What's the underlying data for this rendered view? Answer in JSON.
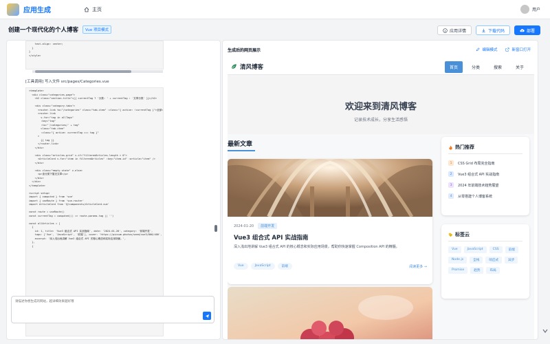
{
  "topbar": {
    "brand": "应用生成",
    "home_label": "主页",
    "user_label": "用户"
  },
  "header": {
    "title": "创建一个现代化的个人博客",
    "mode_tag": "Vue 项目模式",
    "details_btn": "应用详情",
    "download_btn": "下载代码",
    "deploy_btn": "部署"
  },
  "left": {
    "code_top": "    text-align: center;\n  }\n}\n</style>",
    "tool_line": "[工具调用] 写入文件 src/pages/Categories.vue",
    "code_main": "<template>\n  <div class=\"categories-page\">\n    <h2 class=\"section-title\">{{ currentTag ? '分类: ' + currentTag : '文章分类' }}</h2>\n\n    <div class=\"category-tabs\">\n      <router-link to=\"/categories\" class=\"tab-item\" :class=\"{ active: !currentTag }\">全部</router-link>\n      <router-link\n        v-for=\"tag in allTags\"\n        :key=\"tag\"\n        :to=\"'/categories/' + tag\"\n        class=\"tab-item\"\n        :class=\"{ active: currentTag === tag }\"\n      >\n        {{ tag }}\n      </router-link>\n    </div>\n\n    <div class=\"articles-grid\" v-if=\"filteredArticles.length > 0\">\n      <ArticleCard v-for=\"item in filteredArticles\" :key=\"item.id\" :article=\"item\" />\n    </div>\n\n    <div class=\"empty-state\" v-else>\n      <p>该分类下暂无文章</p>\n    </div>\n  </div>\n</template>\n\n<script setup>\nimport { computed } from 'vue'\nimport { useRoute } from 'vue-router'\nimport ArticleCard from '@/components/ArticleCard.vue'\n\nconst route = useRoute()\nconst currentTag = computed(() => route.params.tag || '')\n\nconst allArticles = [\n  {\n    id: 1, title: 'Vue3 组合式 API 实战指南', date: '2024-01-20', category: '前端开发',\n    tags: ['Vue', 'JavaScript', '前端'], cover: 'https://picsum.photos/seed/vue3/800/400',\n    excerpt: '深入浅出地讲解 Vue3 组合式 API 的核心概念和实际应用场景。',\n  },\n  {",
    "input_placeholder": "请描述你想生成的网站，越详细效果越好哦"
  },
  "right": {
    "title": "生成后的网页展示",
    "edit_mode": "编辑模式",
    "open_new": "新窗口打开"
  },
  "site": {
    "brand": "清风博客",
    "nav": [
      {
        "label": "首页",
        "active": true
      },
      {
        "label": "分类",
        "active": false
      },
      {
        "label": "搜索",
        "active": false
      },
      {
        "label": "关于",
        "active": false
      }
    ],
    "hero_title": "欢迎来到清风博客",
    "hero_sub": "记录技术成长，分享生活感悟",
    "section_title": "最新文章",
    "article": {
      "date": "2024-01-20",
      "category": "前端开发",
      "title": "Vue3 组合式 API 实战指南",
      "excerpt": "深入浅出地讲解 Vue3 组合式 API 的核心概念和实际应用场景，帮助你快速掌握 Composition API 的精髓。",
      "tags": [
        "Vue",
        "JavaScript",
        "前端"
      ],
      "more": "阅读更多 →"
    },
    "hot": {
      "title": "热门推荐",
      "items": [
        {
          "num": "1",
          "text": "CSS Grid 布局完全指南"
        },
        {
          "num": "2",
          "text": "Vue3 组合式 API 实战指南"
        },
        {
          "num": "3",
          "text": "2024 年前端技术趋势展望"
        },
        {
          "num": "4",
          "text": "从零搭建个人博客系统"
        }
      ]
    },
    "tagcloud": {
      "title": "标签云",
      "tags": [
        "Vue",
        "JavaScript",
        "CSS",
        "前端",
        "Node.js",
        "全栈",
        "响应式",
        "异步",
        "Promise",
        "趋势",
        "布局"
      ]
    }
  },
  "colors": {
    "primary": "#1677ff",
    "site_accent": "#4a90d9"
  }
}
